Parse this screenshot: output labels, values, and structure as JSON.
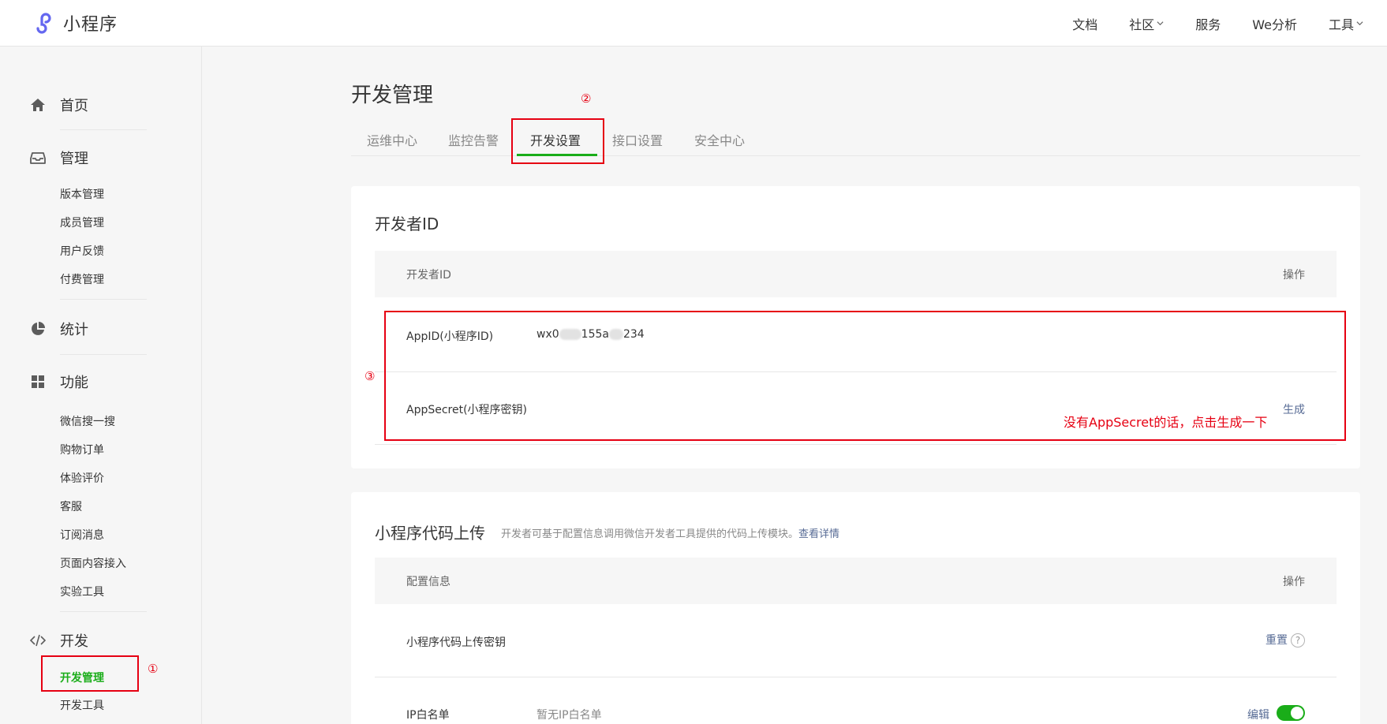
{
  "header": {
    "logo_icon": "miniprogram-logo-icon",
    "logo_text": "小程序",
    "nav": [
      {
        "label": "文档"
      },
      {
        "label": "社区",
        "dropdown": true
      },
      {
        "label": "服务"
      },
      {
        "label": "We分析"
      },
      {
        "label": "工具",
        "dropdown": true
      }
    ]
  },
  "sidebar": {
    "groups": {
      "home": {
        "label": "首页",
        "icon": "home-icon"
      },
      "manage": {
        "label": "管理",
        "icon": "inbox-icon",
        "items": [
          "版本管理",
          "成员管理",
          "用户反馈",
          "付费管理"
        ]
      },
      "stats": {
        "label": "统计",
        "icon": "pie-chart-icon"
      },
      "features": {
        "label": "功能",
        "icon": "grid-icon",
        "items": [
          "微信搜一搜",
          "购物订单",
          "体验评价",
          "客服",
          "订阅消息",
          "页面内容接入",
          "实验工具"
        ]
      },
      "dev": {
        "label": "开发",
        "icon": "code-icon",
        "items": [
          "开发管理",
          "开发工具"
        ],
        "active_item": "开发管理"
      }
    }
  },
  "main": {
    "title": "开发管理",
    "tabs": [
      "运维中心",
      "监控告警",
      "开发设置",
      "接口设置",
      "安全中心"
    ],
    "active_tab": "开发设置",
    "developer_id_card": {
      "title": "开发者ID",
      "columns": [
        "开发者ID",
        "操作"
      ],
      "rows": [
        {
          "label": "AppID(小程序ID)",
          "value_parts": [
            "wx0",
            "155a",
            "234"
          ],
          "action": ""
        },
        {
          "label": "AppSecret(小程序密钥)",
          "value": "",
          "action": "生成"
        }
      ]
    },
    "upload_card": {
      "title": "小程序代码上传",
      "description": "开发者可基于配置信息调用微信开发者工具提供的代码上传模块。",
      "details_link": "查看详情",
      "columns": [
        "配置信息",
        "操作"
      ],
      "rows": [
        {
          "label": "小程序代码上传密钥",
          "value": "",
          "action": "重置",
          "help": "?"
        },
        {
          "label": "IP白名单",
          "value": "暂无IP白名单",
          "action": "编辑",
          "toggle_on": true
        }
      ]
    }
  },
  "annotations": {
    "color": "#e60012",
    "step1": "①",
    "step2": "②",
    "step3": "③",
    "note": "没有AppSecret的话，点击生成一下"
  }
}
